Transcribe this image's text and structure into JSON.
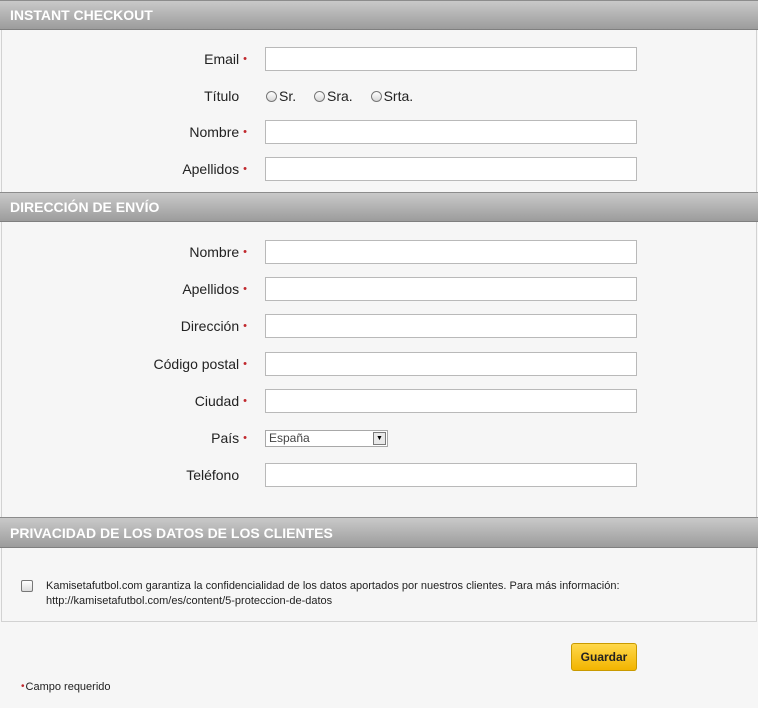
{
  "sections": {
    "instant_checkout": {
      "title": "INSTANT CHECKOUT"
    },
    "shipping_address": {
      "title": "DIRECCIÓN DE ENVÍO"
    },
    "privacy": {
      "title": "PRIVACIDAD DE LOS DATOS DE LOS CLIENTES"
    }
  },
  "required_marker": "•",
  "checkout_form": {
    "email": {
      "label": "Email",
      "value": "",
      "required": true
    },
    "title": {
      "label": "Título",
      "options": [
        "Sr.",
        "Sra.",
        "Srta."
      ],
      "selected": null
    },
    "first_name": {
      "label": "Nombre",
      "value": "",
      "required": true
    },
    "last_name": {
      "label": "Apellidos",
      "value": "",
      "required": true
    }
  },
  "shipping_form": {
    "first_name": {
      "label": "Nombre",
      "value": "",
      "required": true
    },
    "last_name": {
      "label": "Apellidos",
      "value": "",
      "required": true
    },
    "address": {
      "label": "Dirección",
      "value": "",
      "required": true
    },
    "postal_code": {
      "label": "Código postal",
      "value": "",
      "required": true
    },
    "city": {
      "label": "Ciudad",
      "value": "",
      "required": true
    },
    "country": {
      "label": "País",
      "selected": "España",
      "required": true
    },
    "phone": {
      "label": "Teléfono",
      "value": "",
      "required": false
    }
  },
  "privacy": {
    "checked": false,
    "text_line1": "Kamisetafutbol.com garantiza la confidencialidad de los datos aportados por nuestros clientes. Para más información:",
    "text_line2": "http://kamisetafutbol.com/es/content/5-proteccion-de-datos"
  },
  "save_button": {
    "label": "Guardar"
  },
  "footnote": {
    "marker": "•",
    "text": "Campo requerido"
  },
  "colors": {
    "header_gradient_top": "#c9c9c9",
    "header_gradient_bottom": "#9c9c9c",
    "required_mark": "#c0282d",
    "button_yellow": "#f2b400",
    "background": "#f6f6f6"
  }
}
